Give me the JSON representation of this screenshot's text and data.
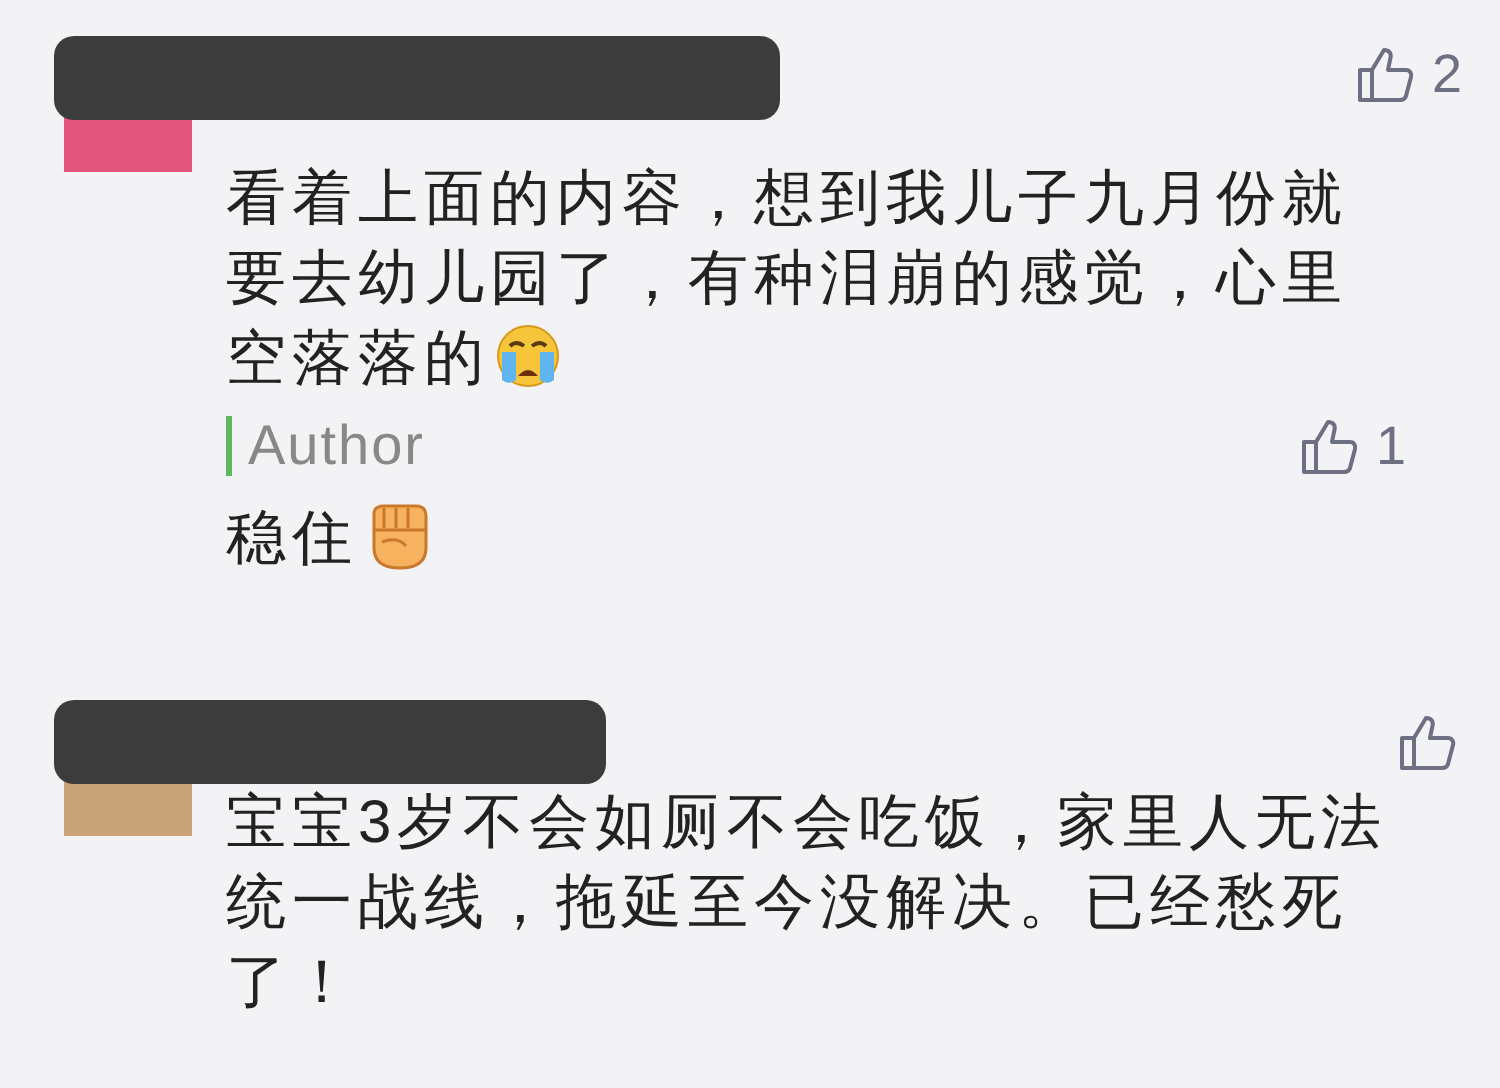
{
  "comments": [
    {
      "text": "看着上面的内容，想到我儿子九月份就要去幼儿园了，有种泪崩的感觉，心里空落落的",
      "icon": {
        "kind": "crying-face"
      },
      "likes": "2",
      "reply": {
        "label": "Author",
        "text": "稳住",
        "icon": {
          "kind": "fist"
        },
        "likes": "1"
      }
    },
    {
      "text": "宝宝3岁不会如厕不会吃饭，家里人无法统一战线，拖延至今没解决。已经愁死了！"
    }
  ]
}
